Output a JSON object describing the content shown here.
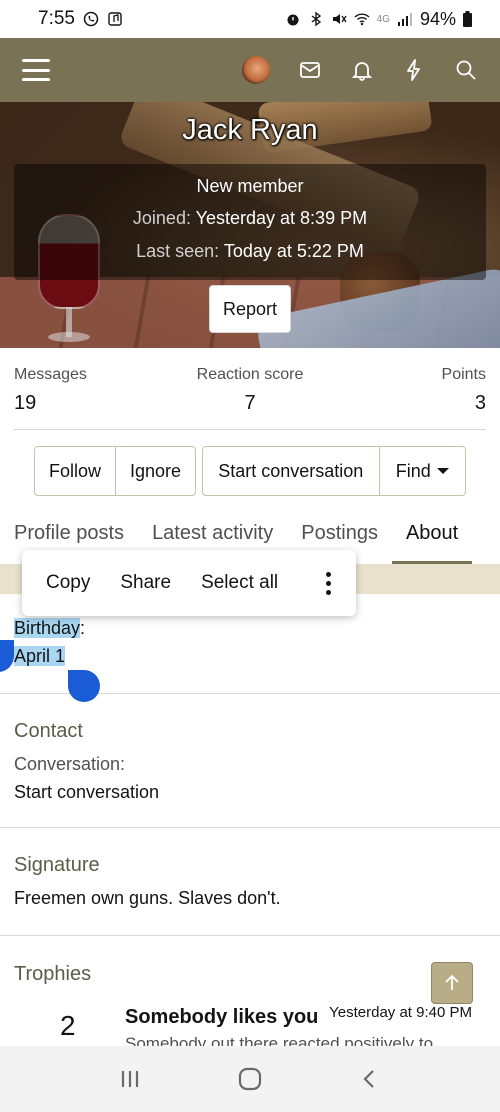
{
  "status_bar": {
    "time": "7:55",
    "network": "4G",
    "battery": "94%"
  },
  "profile": {
    "name": "Jack Ryan",
    "role": "New member",
    "joined_label": "Joined:",
    "joined_value": "Yesterday at 8:39 PM",
    "last_seen_label": "Last seen:",
    "last_seen_value": "Today at 5:22 PM",
    "report_label": "Report"
  },
  "stats": {
    "messages_label": "Messages",
    "messages_value": "19",
    "reaction_label": "Reaction score",
    "reaction_value": "7",
    "points_label": "Points",
    "points_value": "3"
  },
  "actions": {
    "follow": "Follow",
    "ignore": "Ignore",
    "start_conversation": "Start conversation",
    "find": "Find"
  },
  "tabs": [
    {
      "label": "Profile posts"
    },
    {
      "label": "Latest activity"
    },
    {
      "label": "Postings"
    },
    {
      "label": "About"
    }
  ],
  "active_tab": "About",
  "context_menu": {
    "copy": "Copy",
    "share": "Share",
    "select_all": "Select all"
  },
  "about": {
    "birthday_label": "Birthday",
    "birthday_colon": ":",
    "birthday_value": "April 1",
    "contact_title": "Contact",
    "conversation_label": "Conversation:",
    "conversation_value": "Start conversation",
    "signature_title": "Signature",
    "signature_text": "Freemen own guns. Slaves don't.",
    "trophies_title": "Trophies"
  },
  "trophy": {
    "points": "2",
    "title": "Somebody likes you",
    "time": "Yesterday at 9:40 PM",
    "description": "Somebody out there reacted positively to"
  },
  "colors": {
    "navbar": "#7a7255",
    "accent_strip": "#e8e2cd",
    "selection": "#a9d7f2",
    "selection_handle": "#1a5bd6"
  }
}
